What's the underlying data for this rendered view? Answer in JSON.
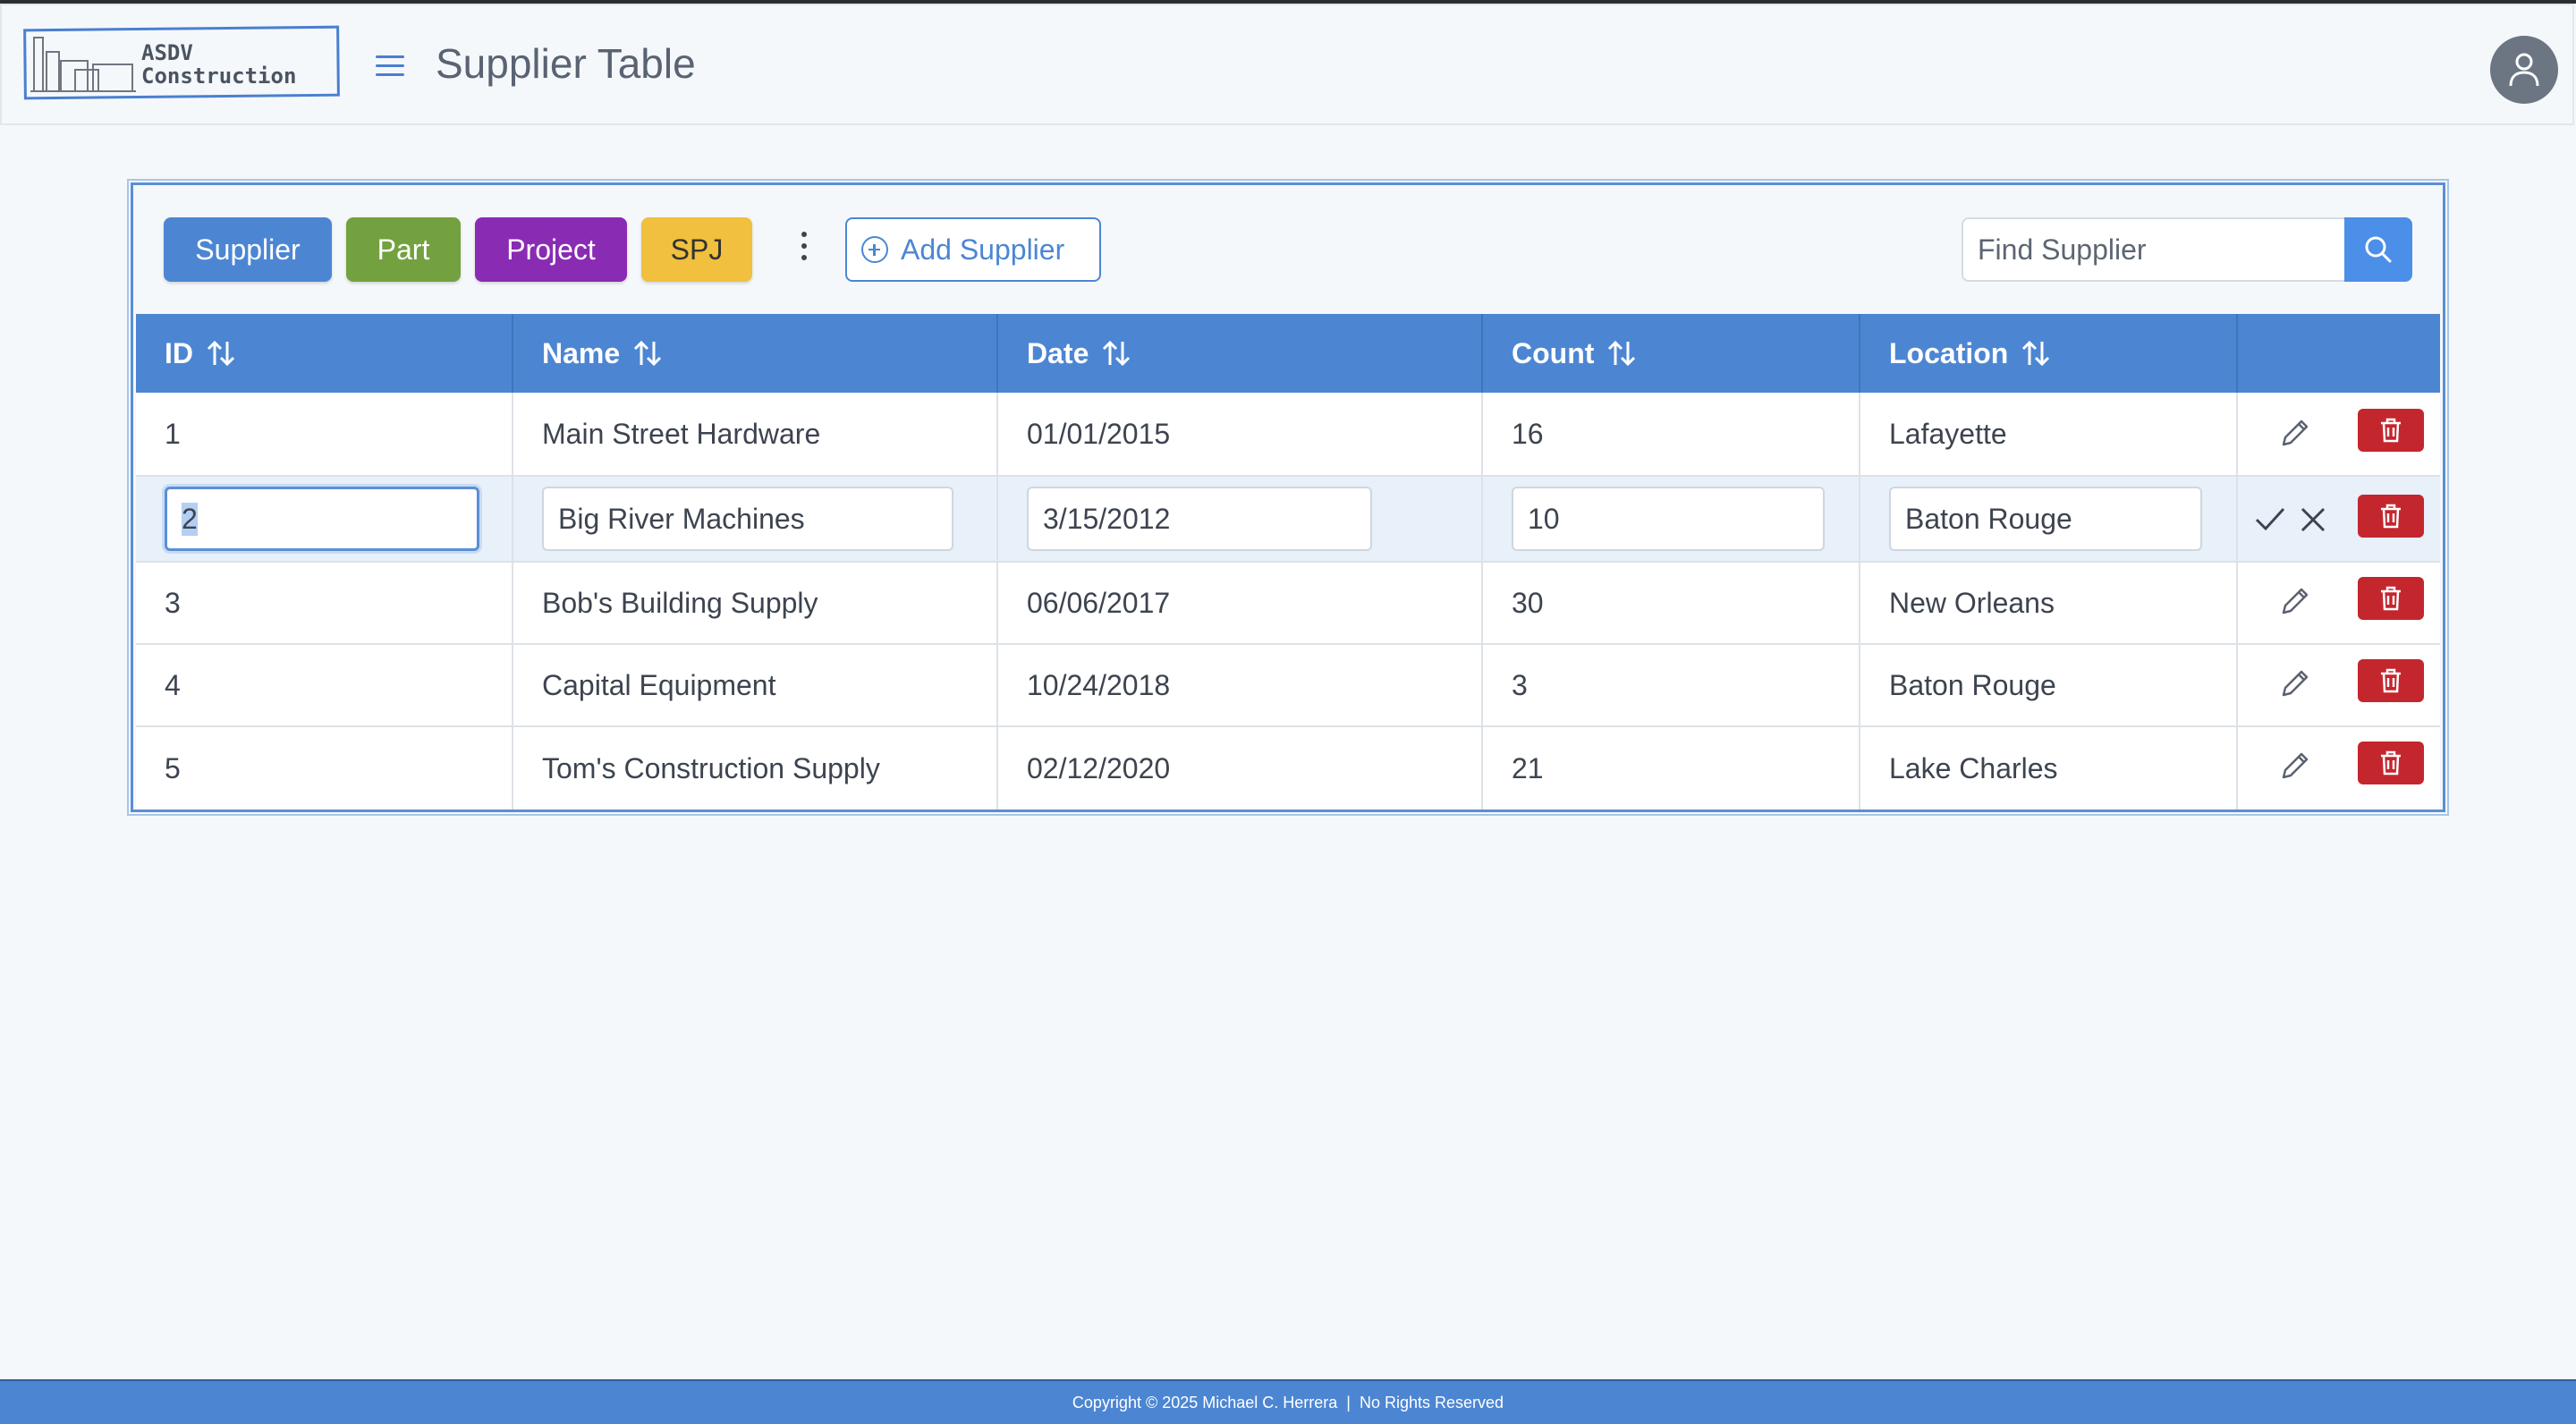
{
  "header": {
    "logo_line1": "ASDV",
    "logo_line2": "Construction",
    "title": "Supplier Table"
  },
  "toolbar": {
    "tabs": [
      "Supplier",
      "Part",
      "Project",
      "SPJ"
    ],
    "add_label": "Add Supplier",
    "search_placeholder": "Find Supplier"
  },
  "table": {
    "columns": [
      "ID",
      "Name",
      "Date",
      "Count",
      "Location"
    ],
    "rows": [
      {
        "id": "1",
        "name": "Main Street Hardware",
        "date": "01/01/2015",
        "count": "16",
        "location": "Lafayette"
      },
      {
        "id": "2",
        "name": "Big River Machines",
        "date": "3/15/2012",
        "count": "10",
        "location": "Baton Rouge"
      },
      {
        "id": "3",
        "name": "Bob's Building Supply",
        "date": "06/06/2017",
        "count": "30",
        "location": "New Orleans"
      },
      {
        "id": "4",
        "name": "Capital Equipment",
        "date": "10/24/2018",
        "count": "3",
        "location": "Baton Rouge"
      },
      {
        "id": "5",
        "name": "Tom's Construction Supply",
        "date": "02/12/2020",
        "count": "21",
        "location": "Lake Charles"
      }
    ],
    "editing_row_index": 1
  },
  "footer": {
    "text": "Copyright © 2025 Michael C. Herrera  |  No Rights Reserved"
  },
  "colors": {
    "primary": "#4c86d3",
    "part": "#74a140",
    "project": "#8a2bb3",
    "spj": "#f0c03e",
    "danger": "#c4262e"
  }
}
